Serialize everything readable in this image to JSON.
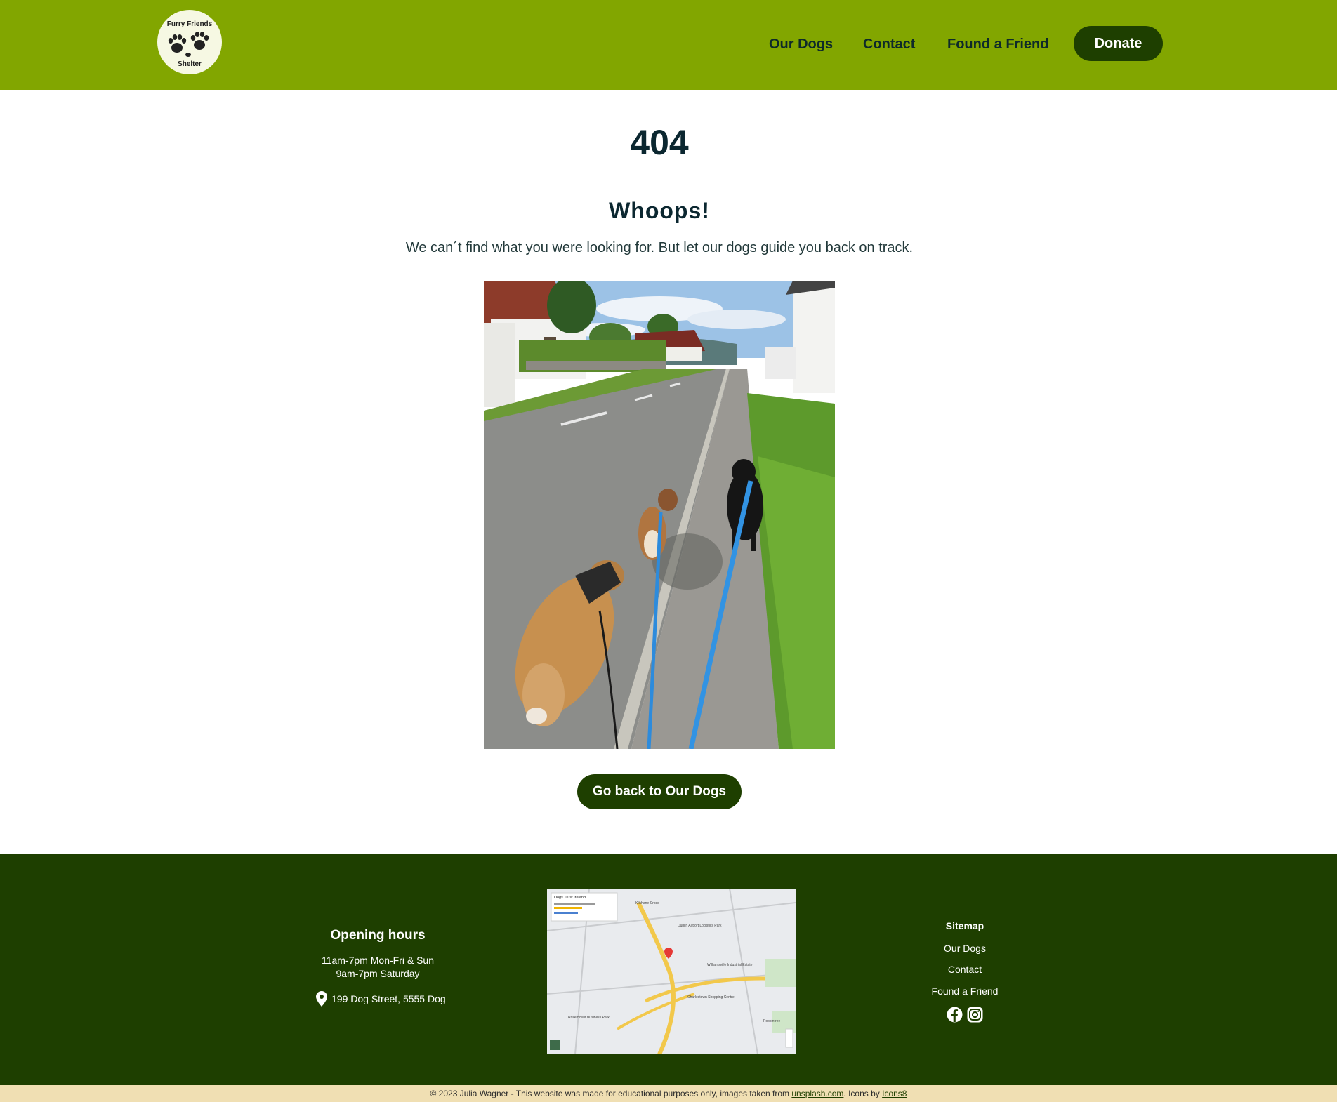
{
  "header": {
    "logo": {
      "text_top": "Furry Friends",
      "text_bottom": "Shelter",
      "icon": "paw-prints-icon"
    },
    "nav": [
      {
        "label": "Our Dogs"
      },
      {
        "label": "Contact"
      },
      {
        "label": "Found a Friend"
      }
    ],
    "donate_label": "Donate"
  },
  "main": {
    "code": "404",
    "heading": "Whoops!",
    "message": "We can´t find what you were looking for. But let our dogs guide you back on track.",
    "image_subject": "three dogs on leashes walking along a road",
    "back_button_label": "Go back to Our Dogs"
  },
  "footer": {
    "hours_title": "Opening hours",
    "hours": [
      "11am-7pm Mon-Fri & Sun",
      "9am-7pm Saturday"
    ],
    "address": "199 Dog Street, 5555 Dog",
    "address_icon": "map-pin-icon",
    "map": {
      "place_name": "Dogs Trust Ireland",
      "labels": [
        "Kilshane Cross",
        "Dublin Airport Logistics Park",
        "Williamsville Industrial Estate",
        "Rosemount Business Park",
        "Charlestown Shopping Centre",
        "Poppintree"
      ]
    },
    "sitemap_title": "Sitemap",
    "sitemap_links": [
      "Our Dogs",
      "Contact",
      "Found a Friend"
    ],
    "social_icons": [
      "facebook-icon",
      "instagram-icon"
    ]
  },
  "copyright": {
    "text": "© 2023 Julia Wagner - This website was made for educational purposes only, images taken from ",
    "link1": "unsplash.com",
    "middle": ". Icons by ",
    "link2": "Icons8"
  },
  "colors": {
    "header_bg": "#82a600",
    "primary_dark": "#1e3f00",
    "copyright_bg": "#f0dfb3",
    "heading_text": "#0b2730"
  }
}
